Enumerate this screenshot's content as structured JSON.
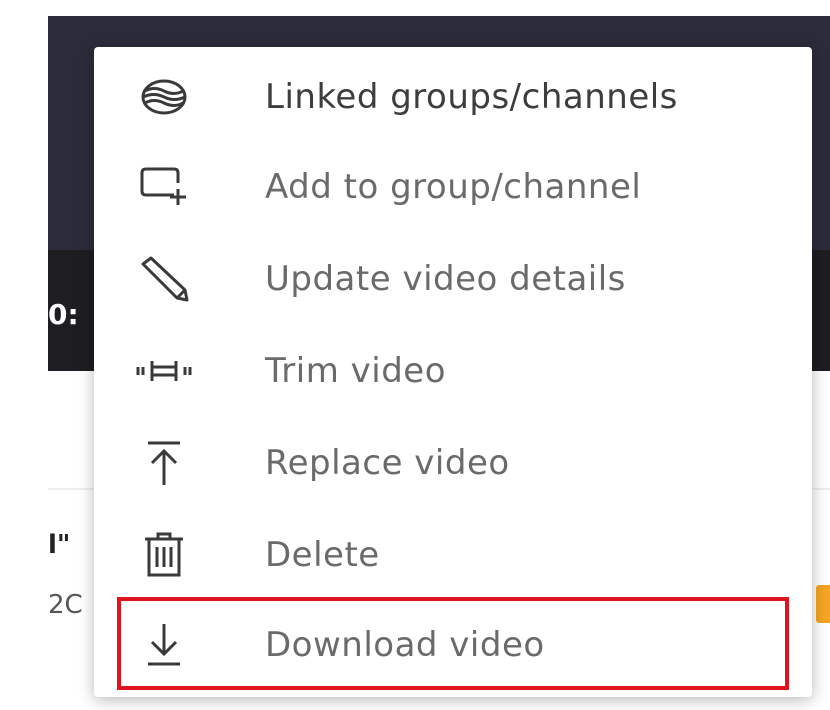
{
  "background": {
    "timecode": "0:",
    "snippet_line1": "l\"",
    "snippet_line2": "2C"
  },
  "menu": {
    "items": [
      {
        "label": "Linked groups/channels",
        "icon": "linked-channels-icon"
      },
      {
        "label": "Add to group/channel",
        "icon": "add-to-group-icon"
      },
      {
        "label": "Update video details",
        "icon": "pencil-icon"
      },
      {
        "label": "Trim video",
        "icon": "trim-icon"
      },
      {
        "label": "Replace video",
        "icon": "upload-icon"
      },
      {
        "label": "Delete",
        "icon": "trash-icon"
      },
      {
        "label": "Download video",
        "icon": "download-icon"
      }
    ],
    "highlighted_item": "Download video"
  },
  "colors": {
    "highlight": "#e0141e",
    "video_bg": "#2b2c3a",
    "badge": "#f4a521"
  }
}
